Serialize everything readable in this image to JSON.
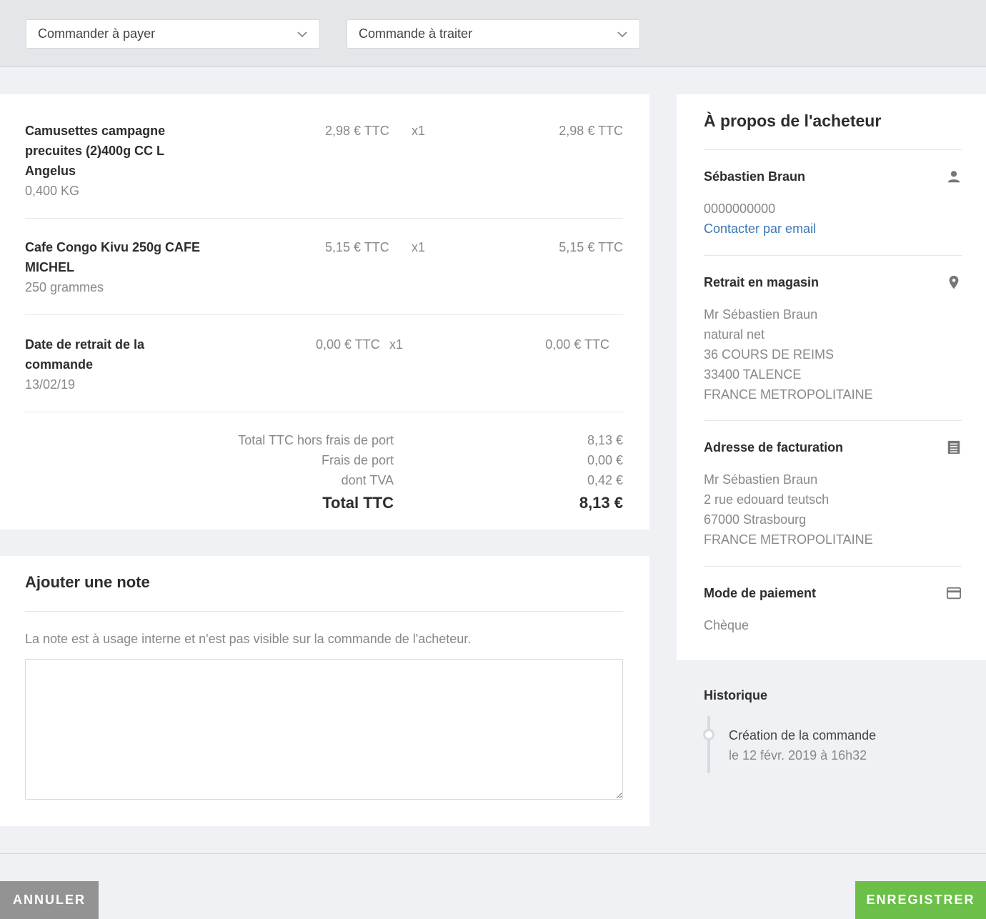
{
  "status_selects": {
    "payment": "Commander à payer",
    "processing": "Commande à traiter"
  },
  "items": [
    {
      "name": "Camusettes campagne precuites (2)400g CC L Angelus",
      "sub": "0,400 KG",
      "unit_price": "2,98 € TTC",
      "qty": "x1",
      "total": "2,98 € TTC"
    },
    {
      "name": "Cafe Congo Kivu 250g CAFE MICHEL",
      "sub": "250 grammes",
      "unit_price": "5,15 € TTC",
      "qty": "x1",
      "total": "5,15 € TTC"
    },
    {
      "name": "Date de retrait de la commande",
      "sub": "13/02/19",
      "unit_price": "0,00 € TTC",
      "qty": "x1",
      "total": "0,00 € TTC"
    }
  ],
  "totals": {
    "subtotal_label": "Total TTC hors frais de port",
    "subtotal": "8,13 €",
    "shipping_label": "Frais de port",
    "shipping": "0,00 €",
    "vat_label": "dont TVA",
    "vat": "0,42 €",
    "grand_label": "Total TTC",
    "grand": "8,13 €"
  },
  "note": {
    "title": "Ajouter une note",
    "description": "La note est à usage interne et n'est pas visible sur la commande de l'acheteur.",
    "value": ""
  },
  "buyer": {
    "title": "À propos de l'acheteur",
    "contact": {
      "name": "Sébastien Braun",
      "phone": "0000000000",
      "email_link": "Contacter par email"
    },
    "pickup": {
      "title": "Retrait en magasin",
      "lines": [
        "Mr Sébastien Braun",
        "natural net",
        "36 COURS DE REIMS",
        "33400 TALENCE",
        "FRANCE METROPOLITAINE"
      ]
    },
    "billing": {
      "title": "Adresse de facturation",
      "lines": [
        "Mr Sébastien Braun",
        "2 rue edouard teutsch",
        "67000 Strasbourg",
        "FRANCE METROPOLITAINE"
      ]
    },
    "payment": {
      "title": "Mode de paiement",
      "method": "Chèque"
    }
  },
  "history": {
    "title": "Historique",
    "events": [
      {
        "label": "Création de la commande",
        "date": "le 12 févr. 2019 à 16h32"
      }
    ]
  },
  "actions": {
    "cancel": "ANNULER",
    "save": "ENREGISTRER"
  },
  "icons": {
    "select_arrow": "chevron-down-icon",
    "contact": "user-icon",
    "pickup": "map-pin-icon",
    "billing": "receipt-icon",
    "payment": "credit-card-icon"
  },
  "colors": {
    "link": "#3b76b6",
    "save_button": "#6cc04a",
    "cancel_button": "#939393"
  }
}
